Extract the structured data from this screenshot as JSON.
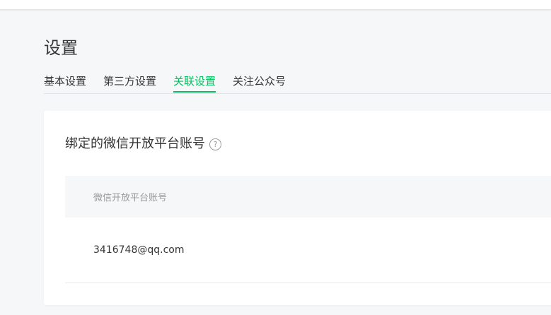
{
  "page": {
    "title": "设置"
  },
  "tabs": [
    {
      "label": "基本设置",
      "active": false
    },
    {
      "label": "第三方设置",
      "active": false
    },
    {
      "label": "关联设置",
      "active": true
    },
    {
      "label": "关注公众号",
      "active": false
    }
  ],
  "card": {
    "title": "绑定的微信开放平台账号",
    "help_icon": "?",
    "table": {
      "columns": [
        "微信开放平台账号"
      ],
      "rows": [
        [
          "3416748@qq.com"
        ]
      ]
    }
  },
  "colors": {
    "accent": "#07c160",
    "background": "#f6f7f9",
    "text": "#353535",
    "muted": "#9a9a9a"
  }
}
